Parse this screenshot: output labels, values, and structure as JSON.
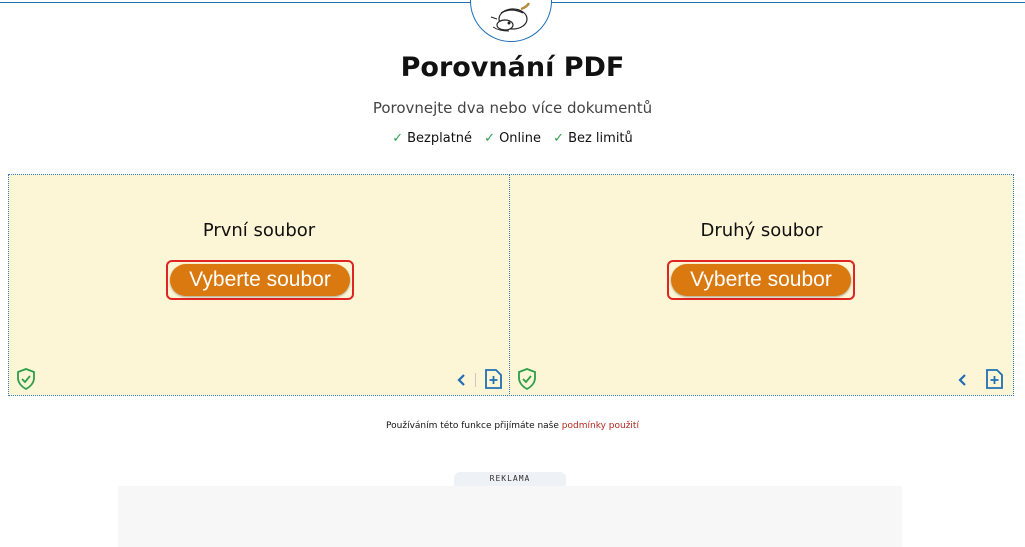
{
  "header": {
    "title": "Porovnání PDF",
    "subtitle": "Porovnejte dva nebo více dokumentů",
    "features": [
      "Bezplatné",
      "Online",
      "Bez limitů"
    ]
  },
  "panels": [
    {
      "label": "První soubor",
      "button_label": "Vyberte soubor"
    },
    {
      "label": "Druhý soubor",
      "button_label": "Vyberte soubor"
    }
  ],
  "terms": {
    "text": "Používáním této funkce přijímáte naše",
    "link": "podmínky použití"
  },
  "ad": {
    "label": "REKLAMA"
  },
  "colors": {
    "accent_blue": "#1f6fb5",
    "button_orange": "#d9790f",
    "panel_bg": "#fdf6d6",
    "check_green": "#2e9e4a",
    "link_red": "#b0281e"
  },
  "icons": [
    "logo-mascot",
    "shield-check-icon",
    "chevron-left-icon",
    "add-file-icon"
  ]
}
